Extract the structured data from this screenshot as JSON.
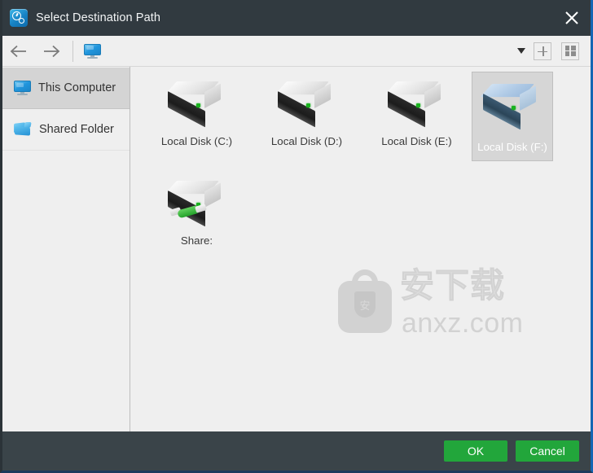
{
  "window": {
    "title": "Select Destination Path",
    "app_icon": "clock-app-icon",
    "close_icon": "close-icon",
    "accent_color": "#1466b4",
    "titlebar_color": "#313a40",
    "footer_color": "#3a4449"
  },
  "toolbar": {
    "back_icon": "arrow-left-icon",
    "forward_icon": "arrow-right-icon",
    "breadcrumb_icon": "monitor-icon",
    "dropdown_icon": "chevron-down-icon",
    "new_folder_icon": "plus-icon",
    "view_icon": "grid-view-icon"
  },
  "sidebar": {
    "items": [
      {
        "label": "This Computer",
        "icon": "monitor-icon",
        "selected": true
      },
      {
        "label": "Shared Folder",
        "icon": "shared-folder-icon",
        "selected": false
      }
    ]
  },
  "content": {
    "drives": [
      {
        "name": "Local Disk (C:)",
        "icon": "hard-disk-icon",
        "selected": false
      },
      {
        "name": "Local Disk (D:)",
        "icon": "hard-disk-icon",
        "selected": false
      },
      {
        "name": "Local Disk (E:)",
        "icon": "hard-disk-icon",
        "selected": false
      },
      {
        "name": "Local Disk (F:)",
        "icon": "hard-disk-icon",
        "selected": true
      },
      {
        "name": "Share:",
        "icon": "network-drive-icon",
        "selected": false
      }
    ],
    "watermark": {
      "logo": "shield-bag-logo",
      "shield_char": "安",
      "cn_text": "安下载",
      "url_text": "anxz.com"
    }
  },
  "footer": {
    "ok_label": "OK",
    "cancel_label": "Cancel",
    "button_color": "#22a63b"
  }
}
